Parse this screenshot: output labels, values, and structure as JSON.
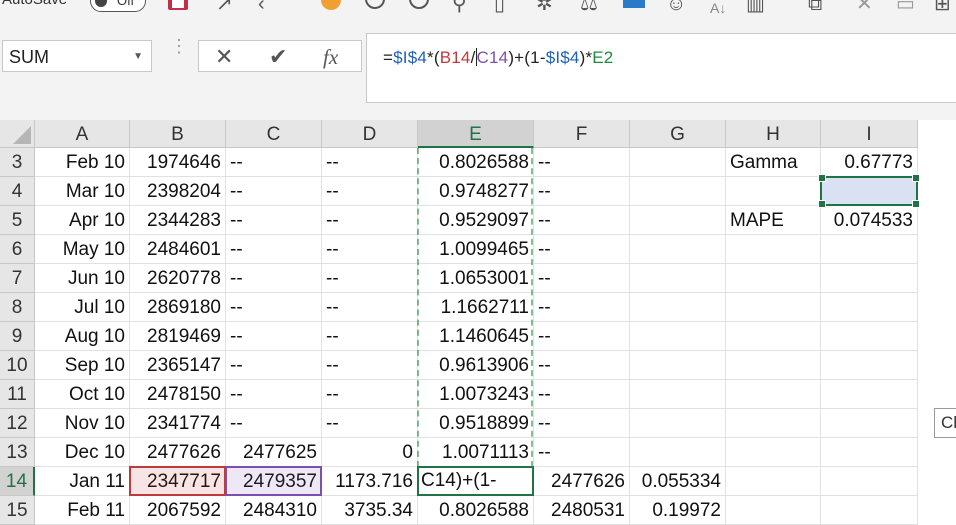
{
  "quick_access": {
    "autosave_label": "AutoSave",
    "autosave_state": "Off",
    "icons": [
      "save-icon",
      "undo-icon",
      "redo-icon",
      "macro-icon",
      "circle-arrow-icon",
      "refresh-icon",
      "find-icon",
      "printer-icon",
      "snowflake-icon",
      "scale-icon",
      "picture-icon",
      "smiley-icon",
      "sort-icon",
      "chart-icon",
      "copy-icon",
      "clear-icon",
      "comment-icon",
      "table-icon"
    ]
  },
  "formula_bar": {
    "name_box": "SUM",
    "fx_label": "fx",
    "formula_parts": [
      {
        "text": "=",
        "color": "plain"
      },
      {
        "text": "$I$4",
        "color": "blue"
      },
      {
        "text": "*(",
        "color": "plain"
      },
      {
        "text": "B14",
        "color": "red"
      },
      {
        "text": "/",
        "color": "plain",
        "cursor_after": true
      },
      {
        "text": "C14",
        "color": "purple"
      },
      {
        "text": ")+(1-",
        "color": "plain"
      },
      {
        "text": "$I$4",
        "color": "blue"
      },
      {
        "text": ")*",
        "color": "plain"
      },
      {
        "text": "E2",
        "color": "green"
      }
    ]
  },
  "sheet": {
    "columns": [
      "A",
      "B",
      "C",
      "D",
      "E",
      "F",
      "G",
      "H",
      "I"
    ],
    "selected_column": "E",
    "selected_row": "14",
    "rows": [
      {
        "row": "3",
        "A": "Feb 10",
        "B": "1974646",
        "C": "--",
        "D": "--",
        "E": "0.8026588",
        "F": "--",
        "G": "",
        "H": "Gamma",
        "I": "0.67773"
      },
      {
        "row": "4",
        "A": "Mar 10",
        "B": "2398204",
        "C": "--",
        "D": "--",
        "E": "0.9748277",
        "F": "--",
        "G": "",
        "H": "",
        "I": ""
      },
      {
        "row": "5",
        "A": "Apr 10",
        "B": "2344283",
        "C": "--",
        "D": "--",
        "E": "0.9529097",
        "F": "--",
        "G": "",
        "H": "MAPE",
        "I": "0.074533"
      },
      {
        "row": "6",
        "A": "May 10",
        "B": "2484601",
        "C": "--",
        "D": "--",
        "E": "1.0099465",
        "F": "--",
        "G": "",
        "H": "",
        "I": ""
      },
      {
        "row": "7",
        "A": "Jun 10",
        "B": "2620778",
        "C": "--",
        "D": "--",
        "E": "1.0653001",
        "F": "--",
        "G": "",
        "H": "",
        "I": ""
      },
      {
        "row": "8",
        "A": "Jul 10",
        "B": "2869180",
        "C": "--",
        "D": "--",
        "E": "1.1662711",
        "F": "--",
        "G": "",
        "H": "",
        "I": ""
      },
      {
        "row": "9",
        "A": "Aug 10",
        "B": "2819469",
        "C": "--",
        "D": "--",
        "E": "1.1460645",
        "F": "--",
        "G": "",
        "H": "",
        "I": ""
      },
      {
        "row": "10",
        "A": "Sep 10",
        "B": "2365147",
        "C": "--",
        "D": "--",
        "E": "0.9613906",
        "F": "--",
        "G": "",
        "H": "",
        "I": ""
      },
      {
        "row": "11",
        "A": "Oct 10",
        "B": "2478150",
        "C": "--",
        "D": "--",
        "E": "1.0073243",
        "F": "--",
        "G": "",
        "H": "",
        "I": ""
      },
      {
        "row": "12",
        "A": "Nov 10",
        "B": "2341774",
        "C": "--",
        "D": "--",
        "E": "0.9518899",
        "F": "--",
        "G": "",
        "H": "",
        "I": ""
      },
      {
        "row": "13",
        "A": "Dec 10",
        "B": "2477626",
        "C": "2477625",
        "D": "0",
        "E": "1.0071113",
        "F": "--",
        "G": "",
        "H": "",
        "I": ""
      },
      {
        "row": "14",
        "A": "Jan 11",
        "B": "2347717",
        "C": "2479357",
        "D": "1173.716",
        "E": "C14)+(1-",
        "F": "2477626",
        "G": "0.055334",
        "H": "",
        "I": ""
      },
      {
        "row": "15",
        "A": "Feb 11",
        "B": "2067592",
        "C": "2484310",
        "D": "3735.34",
        "E": "0.8026588",
        "F": "2480531",
        "G": "0.19972",
        "H": "",
        "I": ""
      }
    ]
  },
  "tooltip_fragment": "Ch",
  "colors": {
    "accent": "#217346",
    "ref_blue": "#1f5fbf",
    "ref_red": "#c0393b",
    "ref_purple": "#7a4fb2",
    "ref_green": "#1e8a3a"
  }
}
